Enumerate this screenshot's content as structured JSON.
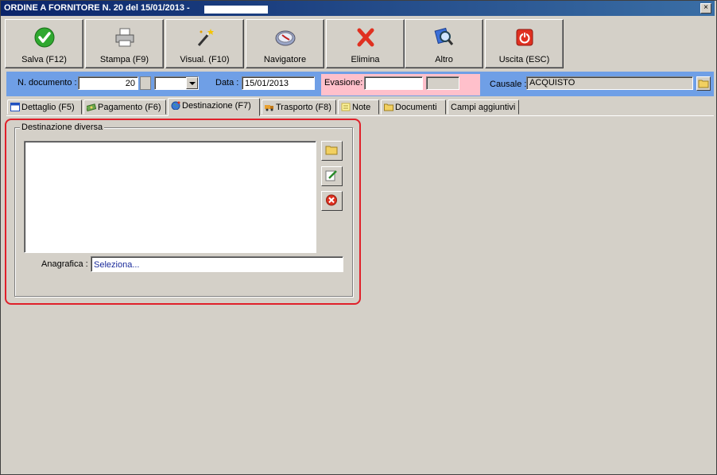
{
  "window": {
    "title": "ORDINE A FORNITORE N. 20 del 15/01/2013 -",
    "close_symbol": "×"
  },
  "toolbar": {
    "buttons": [
      {
        "label": "Salva (F12)",
        "icon": "check-icon",
        "color": "#2fa82f"
      },
      {
        "label": "Stampa (F9)",
        "icon": "printer-icon"
      },
      {
        "label": "Visual. (F10)",
        "icon": "magic-wand-icon"
      },
      {
        "label": "Navigatore",
        "icon": "compass-icon"
      },
      {
        "label": "Elimina",
        "icon": "delete-x-icon",
        "color": "#e03020"
      },
      {
        "label": "Altro",
        "icon": "magnifier-icon"
      },
      {
        "label": "Uscita (ESC)",
        "icon": "power-icon",
        "color": "#e03020"
      }
    ]
  },
  "header": {
    "n_documento_label": "N. documento :",
    "n_documento_value": "20",
    "serie_value": "",
    "data_label": "Data :",
    "data_value": "15/01/2013",
    "evasione_label": "Evasione:",
    "evasione_value": "",
    "evasione_extra": "",
    "causale_label": "Causale :",
    "causale_value": "ACQUISTO"
  },
  "tabs": [
    {
      "label": "Dettaglio (F5)",
      "icon": "grid-icon"
    },
    {
      "label": "Pagamento (F6)",
      "icon": "money-icon"
    },
    {
      "label": "Destinazione (F7)",
      "icon": "globe-icon",
      "active": true
    },
    {
      "label": "Trasporto (F8)",
      "icon": "truck-icon"
    },
    {
      "label": "Note",
      "icon": "note-icon"
    },
    {
      "label": "Documenti",
      "icon": "folder-icon"
    },
    {
      "label": "Campi aggiuntivi",
      "icon": ""
    }
  ],
  "destinazione": {
    "group_label": "Destinazione diversa",
    "text": "",
    "anagrafica_label": "Anagrafica :",
    "anagrafica_placeholder": "Seleziona..."
  },
  "colors": {
    "header_bar": "#6f9fe6",
    "evasione_bg": "#ffc0cb",
    "highlight": "#e0202a"
  }
}
